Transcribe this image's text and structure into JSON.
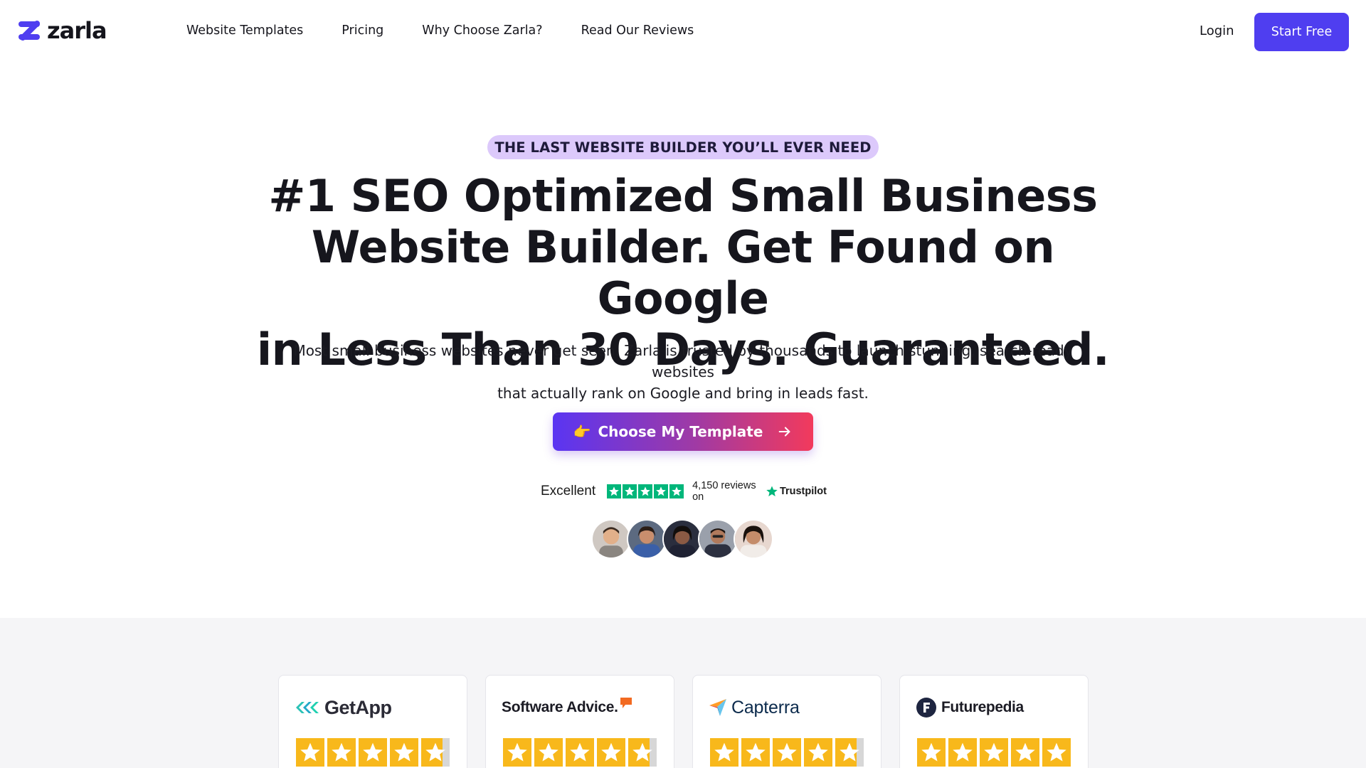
{
  "brand": {
    "name": "zarla",
    "accent": "#4f3ef0"
  },
  "nav": {
    "items": [
      {
        "label": "Website Templates"
      },
      {
        "label": "Pricing"
      },
      {
        "label": "Why Choose Zarla?"
      },
      {
        "label": "Read Our Reviews"
      }
    ],
    "login_label": "Login",
    "start_label": "Start Free"
  },
  "hero": {
    "eyebrow": "THE LAST WEBSITE BUILDER YOU’LL EVER NEED",
    "title_lines": [
      "#1 SEO Optimized Small Business",
      "Website Builder. Get Found on Google",
      "in Less Than 30 Days. Guaranteed."
    ],
    "subtitle_lines": [
      "Most small business websites never get seen. Zarla is trusted by thousands to launch stunning, search-ready websites",
      "that actually rank on Google and bring in leads fast."
    ],
    "cta": {
      "emoji": "👉",
      "label": "Choose My Template",
      "icon": "arrow-right-icon"
    }
  },
  "trustpilot": {
    "rating_word": "Excellent",
    "stars": 5,
    "count_text": "4,150 reviews on",
    "brand": "Trustpilot",
    "color": "#00b67a"
  },
  "avatars": [
    {
      "name": "reviewer-avatar-1",
      "skin": "#e2b08a",
      "bg": "#cfc8c2"
    },
    {
      "name": "reviewer-avatar-2",
      "skin": "#c98e6d",
      "bg": "#3a5fa8"
    },
    {
      "name": "reviewer-avatar-3",
      "skin": "#8a5a44",
      "bg": "#1f2233"
    },
    {
      "name": "reviewer-avatar-4",
      "skin": "#b07a5c",
      "bg": "#6c7282"
    },
    {
      "name": "reviewer-avatar-5",
      "skin": "#c48c6a",
      "bg": "#e7d7cf"
    }
  ],
  "ratings": [
    {
      "brand": "GetApp",
      "stars": 4.75,
      "star_color": "#f8b81b"
    },
    {
      "brand": "Software Advice.",
      "stars": 4.75,
      "star_color": "#f8b81b"
    },
    {
      "brand": "Capterra",
      "stars": 4.75,
      "star_color": "#f8b81b"
    },
    {
      "brand": "Futurepedia",
      "stars": 5,
      "star_color": "#f8b81b"
    }
  ]
}
